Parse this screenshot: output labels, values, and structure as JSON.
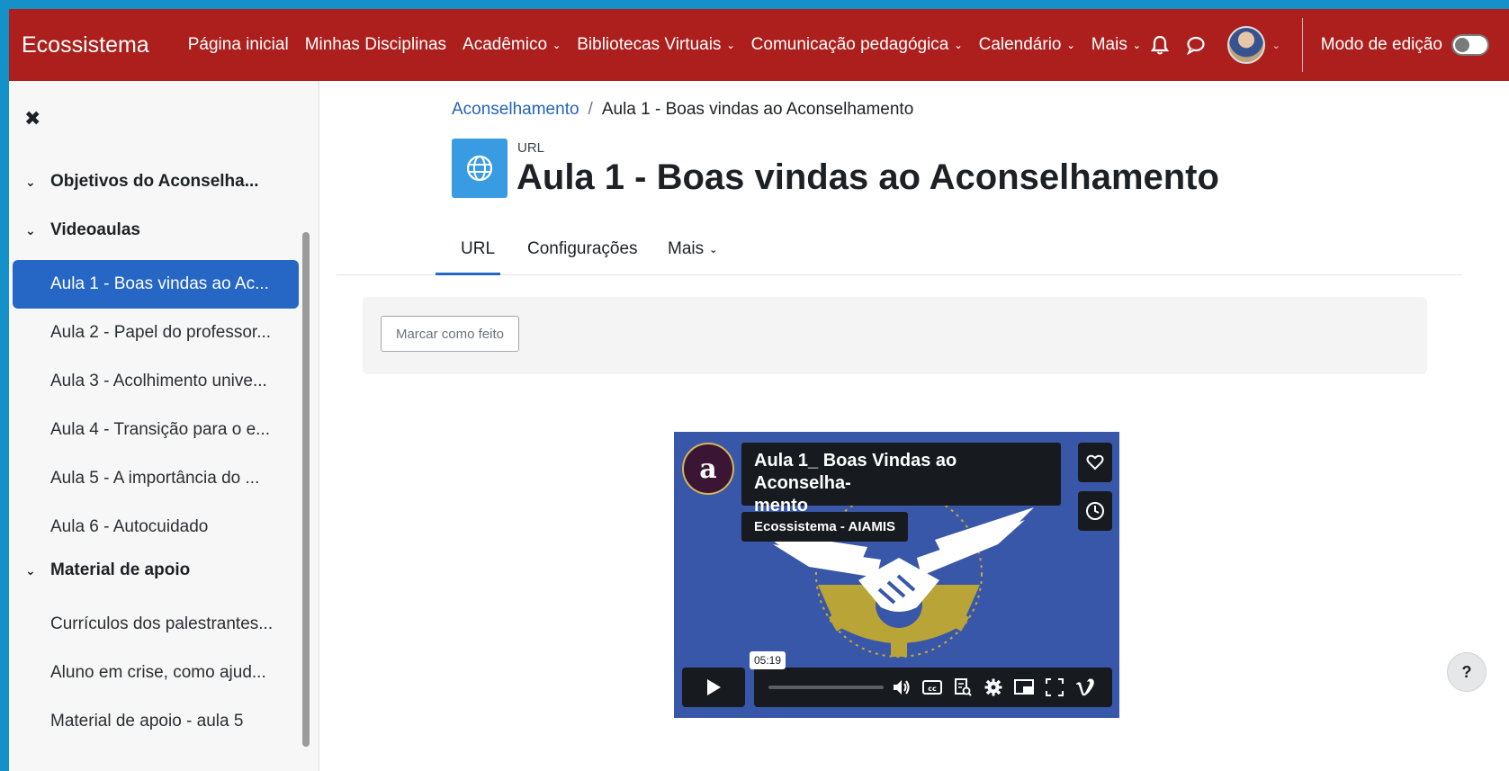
{
  "navbar": {
    "brand": "Ecossistema",
    "items": [
      {
        "label": "Página inicial",
        "dropdown": false
      },
      {
        "label": "Minhas Disciplinas",
        "dropdown": false
      },
      {
        "label": "Acadêmico",
        "dropdown": true
      },
      {
        "label": "Bibliotecas Virtuais",
        "dropdown": true
      },
      {
        "label": "Comunicação pedagógica",
        "dropdown": true
      },
      {
        "label": "Calendário",
        "dropdown": true
      },
      {
        "label": "Mais",
        "dropdown": true
      }
    ],
    "edit_mode_label": "Modo de edição",
    "icons": [
      "bell-icon",
      "chat-icon",
      "avatar",
      "chevron-down-icon"
    ]
  },
  "sidebar": {
    "sections": [
      {
        "label": "Objetivos do Aconselha..."
      },
      {
        "label": "Videoaulas"
      },
      {
        "label": "Material de apoio"
      }
    ],
    "items": [
      {
        "label": "Aula 1 - Boas vindas ao Ac...",
        "active": true
      },
      {
        "label": "Aula 2 - Papel do professor..."
      },
      {
        "label": "Aula 3 - Acolhimento unive..."
      },
      {
        "label": "Aula 4 - Transição para o e..."
      },
      {
        "label": "Aula 5 - A importância do ..."
      },
      {
        "label": "Aula 6 - Autocuidado"
      },
      {
        "label": "Currículos dos palestrantes..."
      },
      {
        "label": "Aluno em crise, como ajud..."
      },
      {
        "label": "Material de apoio - aula 5"
      }
    ]
  },
  "breadcrumb": {
    "parent": "Aconselhamento",
    "separator": "/",
    "current": "Aula 1 - Boas vindas ao Aconselhamento"
  },
  "page": {
    "activity_type": "URL",
    "title": "Aula 1 - Boas vindas ao Aconselhamento"
  },
  "tabs": [
    {
      "label": "URL",
      "active": true
    },
    {
      "label": "Configurações"
    },
    {
      "label": "Mais"
    }
  ],
  "completion": {
    "button_label": "Marcar como feito"
  },
  "video": {
    "channel_avatar_letter": "a",
    "title": "Aula 1_ Boas Vindas ao Aconselha-mento",
    "title_line1": "Aula 1_ Boas Vindas ao Aconselha-",
    "title_line2": "mento",
    "channel": "Ecossistema - AIAMIS",
    "time": "05:19",
    "colors": {
      "background": "#3957a8",
      "gear": "#b8a437",
      "wings": "#ffffff"
    }
  },
  "help": {
    "label": "?"
  },
  "colors": {
    "navbar": "#ac1f1d",
    "accent": "#2666c4",
    "border_outer": "#1591c9"
  }
}
